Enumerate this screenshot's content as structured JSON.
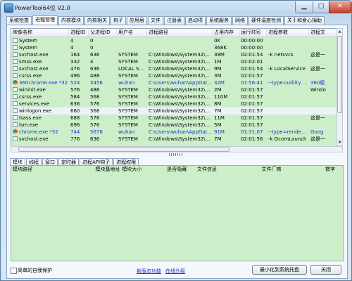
{
  "window": {
    "title": "PowerTool64位 V2.0",
    "min_label": "▁",
    "max_label": "□",
    "close_label": "✕"
  },
  "tabs": [
    {
      "label": "系统检查"
    },
    {
      "label": "进程管理"
    },
    {
      "label": "内核模块"
    },
    {
      "label": "内核相关"
    },
    {
      "label": "钩子"
    },
    {
      "label": "应用层"
    },
    {
      "label": "文件"
    },
    {
      "label": "注册表"
    },
    {
      "label": "启动项"
    },
    {
      "label": "系统服务"
    },
    {
      "label": "网络"
    },
    {
      "label": "硬件温度检测"
    },
    {
      "label": "关于和爱心捐助"
    }
  ],
  "active_tab": "进程管理",
  "process_table": {
    "columns": [
      "映像名称",
      "进程ID",
      "父进程ID",
      "用户名",
      "进程路径",
      "占用内存",
      "运行时间",
      "进程参数",
      "进程文"
    ],
    "rows": [
      {
        "icon": "file",
        "name": "System",
        "pid": "4",
        "ppid": "0",
        "user": "",
        "path": "",
        "mem": "0K",
        "time": "00:00:00",
        "args": "",
        "extra": "",
        "style": "green"
      },
      {
        "icon": "file",
        "name": "System",
        "pid": "4",
        "ppid": "0",
        "user": "",
        "path": "",
        "mem": "368K",
        "time": "00:00:00",
        "args": "",
        "extra": "",
        "style": "green"
      },
      {
        "icon": "file",
        "name": "svchost.exe",
        "pid": "164",
        "ppid": "636",
        "user": "SYSTEM",
        "path": "C:\\Windows\\System32\\...",
        "mem": "38M",
        "time": "02:01:54",
        "args": "-k netsvcs",
        "extra": "这是一",
        "style": "green"
      },
      {
        "icon": "file",
        "name": "smss.exe",
        "pid": "332",
        "ppid": "4",
        "user": "SYSTEM",
        "path": "C:\\Windows\\System32\\...",
        "mem": "1M",
        "time": "02:02:01",
        "args": "",
        "extra": "",
        "style": "green"
      },
      {
        "icon": "file",
        "name": "svchost.exe",
        "pid": "476",
        "ppid": "636",
        "user": "LOCAL S...",
        "path": "C:\\Windows\\System32\\...",
        "mem": "9M",
        "time": "02:01:54",
        "args": "-k LocalService",
        "extra": "这是一",
        "style": "green"
      },
      {
        "icon": "file",
        "name": "csrss.exe",
        "pid": "496",
        "ppid": "488",
        "user": "SYSTEM",
        "path": "C:\\Windows\\System32\\...",
        "mem": "3M",
        "time": "02:01:57",
        "args": "",
        "extra": "",
        "style": "green"
      },
      {
        "icon": "chrome",
        "name": "360chrome.exe *32",
        "pid": "524",
        "ppid": "3456",
        "user": "wuhan",
        "path": "C:\\Users\\wuhan\\AppDat...",
        "mem": "32M",
        "time": "01:56:41",
        "args": "--type=utility ...",
        "extra": "360极",
        "style": "blue"
      },
      {
        "icon": "file",
        "name": "wininit.exe",
        "pid": "576",
        "ppid": "488",
        "user": "SYSTEM",
        "path": "C:\\Windows\\System32\\...",
        "mem": "2M",
        "time": "02:01:57",
        "args": "",
        "extra": "Windo",
        "style": "green"
      },
      {
        "icon": "file",
        "name": "csrss.exe",
        "pid": "584",
        "ppid": "568",
        "user": "SYSTEM",
        "path": "C:\\Windows\\System32\\...",
        "mem": "110M",
        "time": "02:01:57",
        "args": "",
        "extra": "",
        "style": "green"
      },
      {
        "icon": "file",
        "name": "services.exe",
        "pid": "636",
        "ppid": "576",
        "user": "SYSTEM",
        "path": "C:\\Windows\\System32\\...",
        "mem": "8M",
        "time": "02:01:57",
        "args": "",
        "extra": "",
        "style": "green"
      },
      {
        "icon": "file",
        "name": "winlogon.exe",
        "pid": "660",
        "ppid": "568",
        "user": "SYSTEM",
        "path": "C:\\Windows\\System32\\...",
        "mem": "7M",
        "time": "02:01:57",
        "args": "",
        "extra": "",
        "style": "sel"
      },
      {
        "icon": "file",
        "name": "lsass.exe",
        "pid": "688",
        "ppid": "576",
        "user": "SYSTEM",
        "path": "C:\\Windows\\System32\\...",
        "mem": "11M",
        "time": "02:01:57",
        "args": "",
        "extra": "这是一",
        "style": "green"
      },
      {
        "icon": "file",
        "name": "lsm.exe",
        "pid": "696",
        "ppid": "576",
        "user": "SYSTEM",
        "path": "C:\\Windows\\System32\\...",
        "mem": "5M",
        "time": "02:01:57",
        "args": "",
        "extra": "",
        "style": "green"
      },
      {
        "icon": "chrome",
        "name": "chrome.exe *32",
        "pid": "744",
        "ppid": "5676",
        "user": "wuhan",
        "path": "C:\\Users\\wuhan\\AppDat...",
        "mem": "91M",
        "time": "01:31:07",
        "args": "--type=rende...",
        "extra": "Goog",
        "style": "blue"
      },
      {
        "icon": "file",
        "name": "svchost.exe",
        "pid": "776",
        "ppid": "636",
        "user": "SYSTEM",
        "path": "C:\\Windows\\System32\\...",
        "mem": "7M",
        "time": "02:01:56",
        "args": "-k DcomLaunch",
        "extra": "这是一",
        "style": "green"
      },
      {
        "icon": "file",
        "name": "",
        "pid": "",
        "ppid": "",
        "user": "",
        "path": "",
        "mem": "",
        "time": "",
        "args": "",
        "extra": "",
        "style": "green"
      }
    ]
  },
  "sub_tabs": [
    {
      "label": "模块"
    },
    {
      "label": "线程"
    },
    {
      "label": "窗口"
    },
    {
      "label": "定时器"
    },
    {
      "label": "进程API钩子"
    },
    {
      "label": "进程权限"
    }
  ],
  "module_table": {
    "columns": [
      "模块路径",
      "模块基地址",
      "模块大小",
      "是否隐藏",
      "文件信息",
      "文件厂商",
      "数字"
    ]
  },
  "footer": {
    "checkbox_label": "简单的自我保护",
    "link_update": "新版本功能",
    "link_online": "在线升级",
    "btn_minimize_tray": "最小化到系统托盘",
    "btn_close": "关闭"
  },
  "colors": {
    "row_green": "#ccefc9",
    "row_blue_text": "#1a2fd6",
    "link": "#1638c9"
  }
}
